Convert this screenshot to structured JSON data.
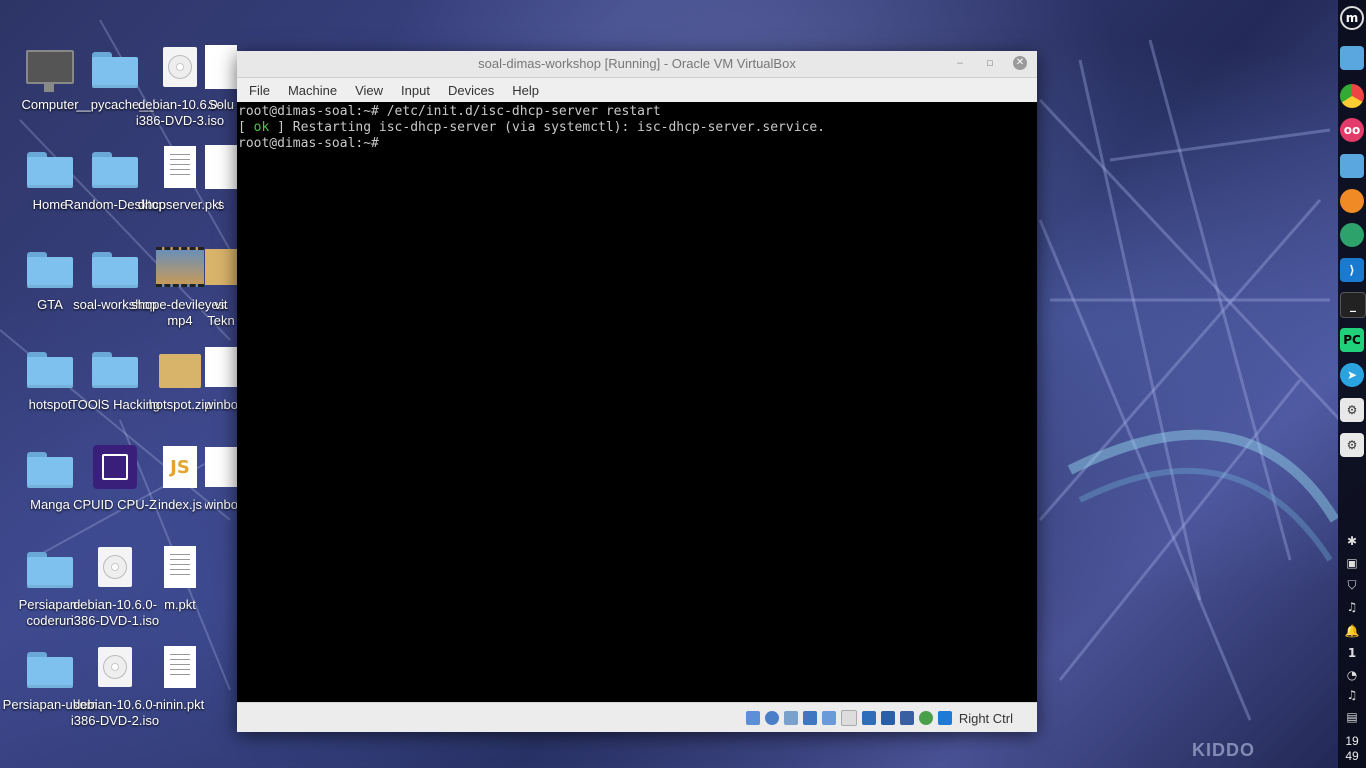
{
  "desktop": {
    "icons": [
      {
        "label": "Computer",
        "icon": "computer-icon"
      },
      {
        "label": "__pycache__",
        "icon": "folder-icon"
      },
      {
        "label": "debian-10.6.0-\ni386-DVD-3.iso",
        "icon": "disc-icon"
      },
      {
        "label": "Home",
        "icon": "home-folder-icon"
      },
      {
        "label": "Random-Desktop",
        "icon": "folder-icon"
      },
      {
        "label": "dhcpserver.pkt",
        "icon": "document-icon"
      },
      {
        "label": "GTA",
        "icon": "folder-icon"
      },
      {
        "label": "soal-workshop",
        "icon": "folder-icon"
      },
      {
        "label": "shope-devileyes.\nmp4",
        "icon": "video-icon"
      },
      {
        "label": "hotspot",
        "icon": "folder-icon"
      },
      {
        "label": "TOOlS Hacking",
        "icon": "folder-icon"
      },
      {
        "label": "hotspot.zip",
        "icon": "archive-icon"
      },
      {
        "label": "Manga",
        "icon": "folder-icon"
      },
      {
        "label": "CPUID CPU-Z",
        "icon": "cpu-z-icon"
      },
      {
        "label": "index.js",
        "icon": "js-file-icon"
      },
      {
        "label": "Persiapan-\ncoderun",
        "icon": "folder-icon"
      },
      {
        "label": "debian-10.6.0-\ni386-DVD-1.iso",
        "icon": "disc-icon"
      },
      {
        "label": "m.pkt",
        "icon": "document-icon"
      },
      {
        "label": "Persiapan-ukom",
        "icon": "folder-icon"
      },
      {
        "label": "debian-10.6.0-\ni386-DVD-2.iso",
        "icon": "disc-icon"
      },
      {
        "label": "ninin.pkt",
        "icon": "document-icon"
      }
    ],
    "partial_labels": {
      "col4_row1": "Solu",
      "col4_row2": "s",
      "col4_row3": "vit\nTekn",
      "col4_row4": "winbo",
      "col4_row5": "winbo"
    }
  },
  "vbox": {
    "title": "soal-dimas-workshop [Running] - Oracle VM VirtualBox",
    "menu": [
      "File",
      "Machine",
      "View",
      "Input",
      "Devices",
      "Help"
    ],
    "terminal": {
      "line1": "root@dimas-soal:~# /etc/init.d/isc-dhcp-server restart",
      "line2_open": "[ ",
      "line2_ok": "ok",
      "line2_rest": " ] Restarting isc-dhcp-server (via systemctl): isc-dhcp-server.service.",
      "line3": "root@dimas-soal:~# "
    },
    "status": {
      "host_key": "Right Ctrl"
    }
  },
  "dock": {
    "apps": [
      "linux-mint-menu-icon",
      "files-icon",
      "chrome-icon",
      "flickr-icon",
      "files-icon",
      "firefox-icon",
      "android-studio-icon",
      "vscode-icon",
      "terminal-icon",
      "pycharm-icon",
      "telegram-icon",
      "settings-icon",
      "settings-icon"
    ],
    "pycharm_label": "PC",
    "workspace": "1",
    "clock_hour": "19",
    "clock_minute": "49"
  },
  "wallpaper": {
    "watermark": "KIDDO"
  },
  "colors": {
    "terminal_bg": "#000000",
    "ok_green": "#4ac44a",
    "folder": "#7ec0ee"
  }
}
